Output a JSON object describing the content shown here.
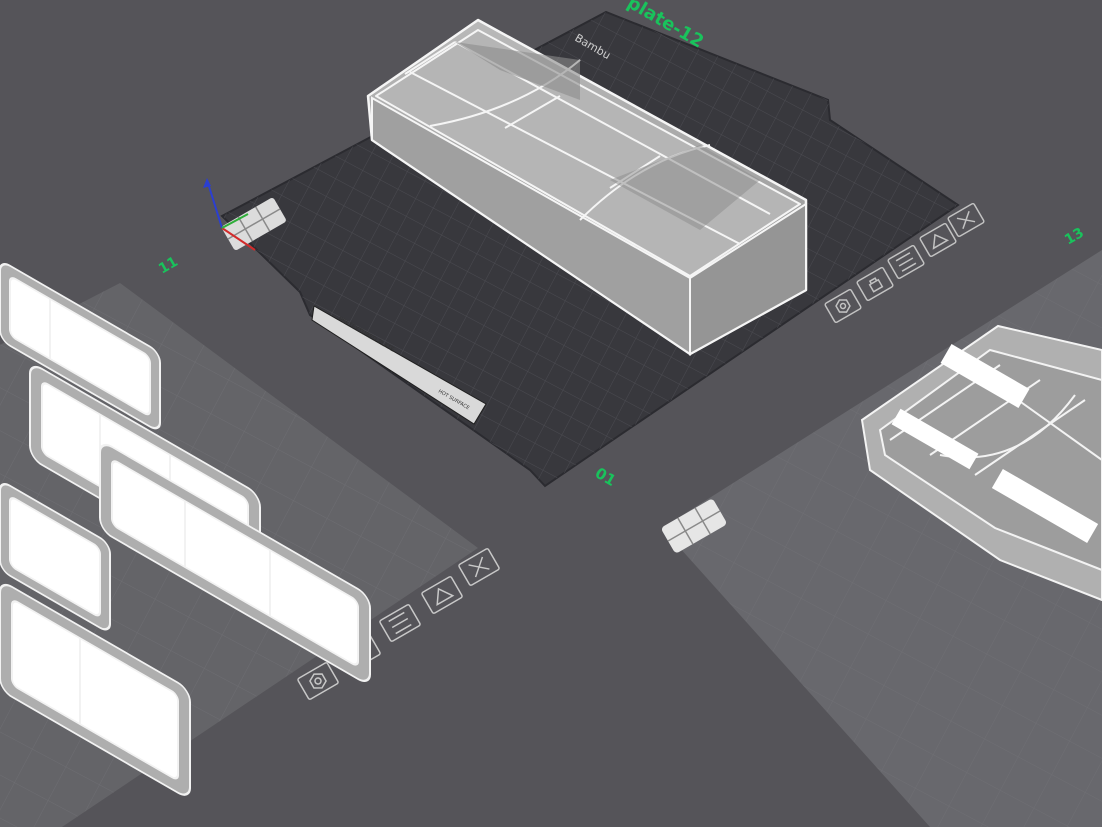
{
  "plates": {
    "active": {
      "name_label": "plate-12",
      "number_label": "01",
      "brand_text": "Bambu",
      "sticker_text": "PEI TEXTURED PLATE",
      "sticker_warning": "HOT SURFACE",
      "toolbar_icons": [
        "close-icon",
        "orient-icon",
        "arrange-icon",
        "lock-icon",
        "settings-icon"
      ]
    },
    "left": {
      "number_label": "11",
      "toolbar_icons": [
        "close-icon",
        "orient-icon",
        "arrange-icon",
        "lock-icon",
        "settings-icon"
      ]
    },
    "right": {
      "number_label": "13"
    }
  },
  "colors": {
    "background": "#555459",
    "active_plate": "#38383d",
    "inactive_plate": "#6a6a6f",
    "label_green": "#19c35c",
    "model_fill": "#a9a9a9",
    "axis_x": "#d22b2b",
    "axis_y": "#2fae3a",
    "axis_z": "#2b3fd2"
  }
}
